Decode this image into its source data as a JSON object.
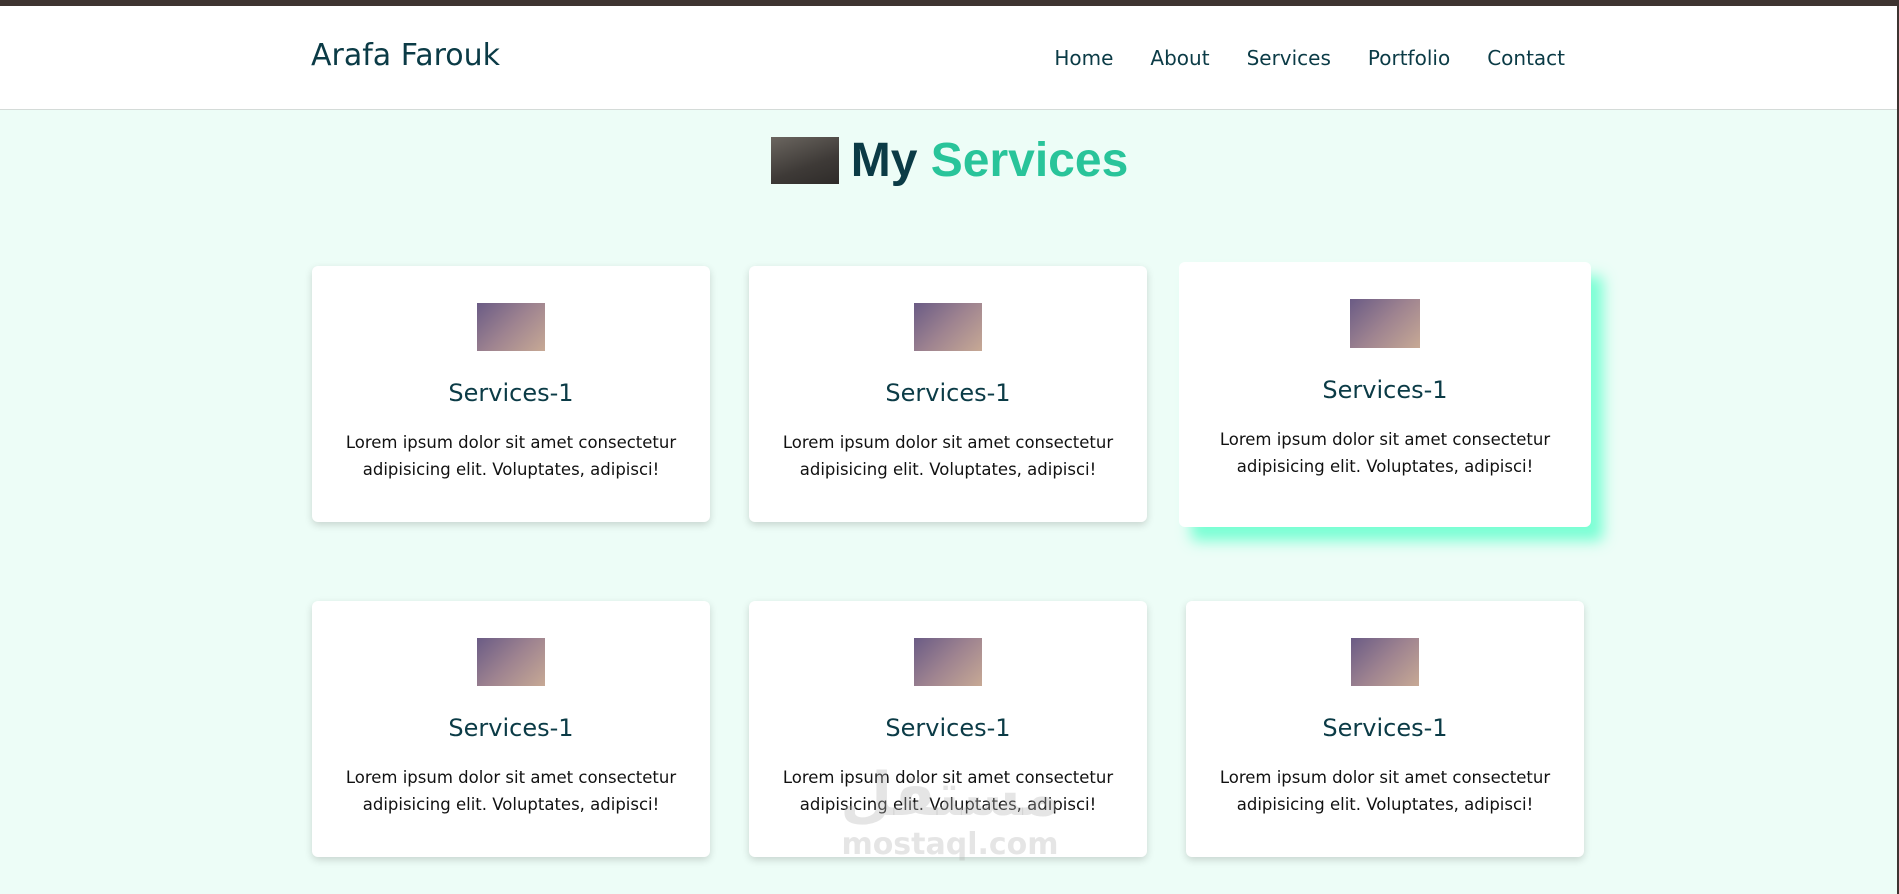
{
  "header": {
    "logo": "Arafa Farouk",
    "nav": [
      "Home",
      "About",
      "Services",
      "Portfolio",
      "Contact"
    ]
  },
  "section": {
    "title_part1": "My",
    "title_part2": "Services"
  },
  "cards": [
    {
      "title": "Services-1",
      "text": "Lorem ipsum dolor sit amet consectetur adipisicing elit. Voluptates, adipisci!"
    },
    {
      "title": "Services-1",
      "text": "Lorem ipsum dolor sit amet consectetur adipisicing elit. Voluptates, adipisci!"
    },
    {
      "title": "Services-1",
      "text": "Lorem ipsum dolor sit amet consectetur adipisicing elit. Voluptates, adipisci!"
    },
    {
      "title": "Services-1",
      "text": "Lorem ipsum dolor sit amet consectetur adipisicing elit. Voluptates, adipisci!"
    },
    {
      "title": "Services-1",
      "text": "Lorem ipsum dolor sit amet consectetur adipisicing elit. Voluptates, adipisci!"
    },
    {
      "title": "Services-1",
      "text": "Lorem ipsum dolor sit amet consectetur adipisicing elit. Voluptates, adipisci!"
    }
  ],
  "watermark": {
    "arabic": "مستقل",
    "latin": "mostaql.com"
  },
  "colors": {
    "primary_text": "#0b3b46",
    "accent": "#29c49a",
    "background": "#edfdf7",
    "hover_glow": "#54ffc8"
  }
}
